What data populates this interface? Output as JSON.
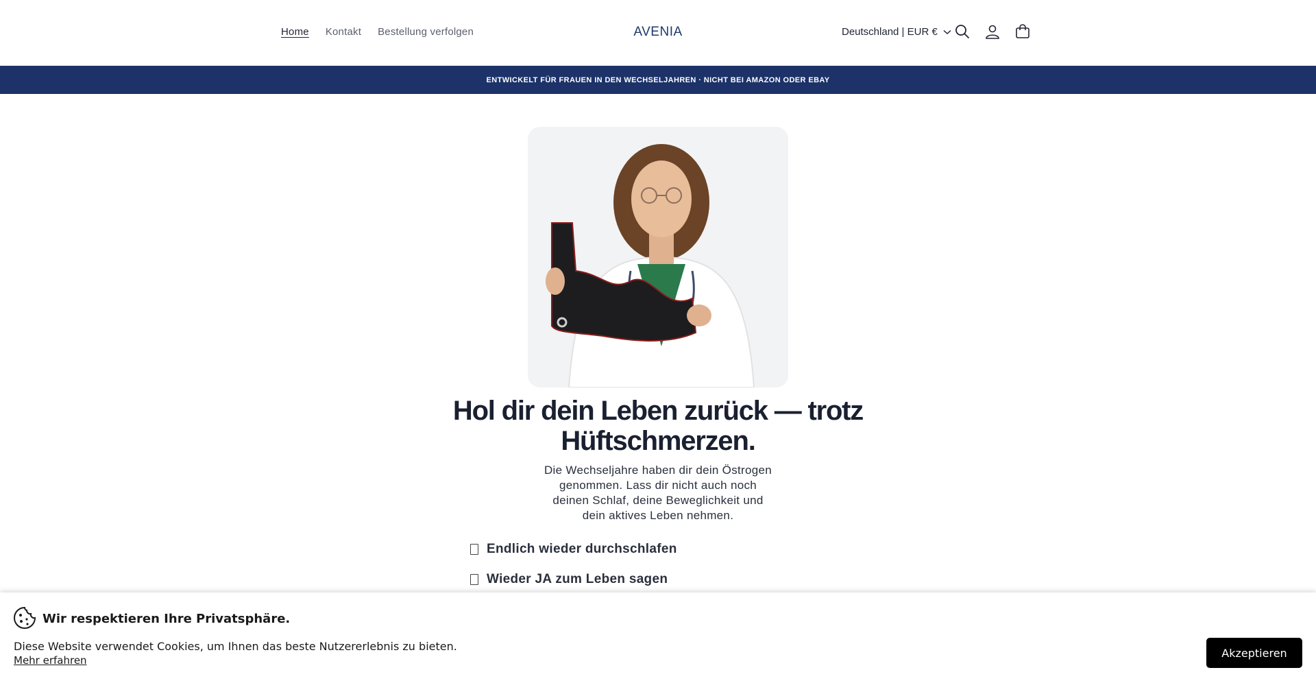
{
  "header": {
    "nav": [
      {
        "label": "Home"
      },
      {
        "label": "Kontakt"
      },
      {
        "label": "Bestellung verfolgen"
      }
    ],
    "logo": "AVENIA",
    "locale": "Deutschland | EUR €",
    "icons": [
      "search-icon",
      "account-icon",
      "cart-icon"
    ]
  },
  "announcement": "ENTWICKELT FÜR FRAUEN IN DEN WECHSELJAHREN · NICHT BEI AMAZON ODER EBAY",
  "hero": {
    "headline_line1": "Hol dir dein Leben zurück — trotz",
    "headline_line2": "Hüftschmerzen.",
    "subtext": "Die Wechseljahre haben dir dein Östrogen genommen. Lass dir nicht auch noch deinen Schlaf, deine Beweglichkeit und dein aktives Leben nehmen.",
    "bullets": [
      "Endlich wieder durchschlafen",
      "Wieder JA zum Leben sagen"
    ]
  },
  "cookie": {
    "title": "Wir respektieren Ihre Privatsphäre.",
    "text": "Diese Website verwendet Cookies, um Ihnen das beste Nutzererlebnis zu bieten.",
    "link": "Mehr erfahren",
    "accept": "Akzeptieren"
  },
  "colors": {
    "announcement_bg": "#1c3268",
    "logo": "#1e3a6a",
    "accept_bg": "#000000"
  }
}
